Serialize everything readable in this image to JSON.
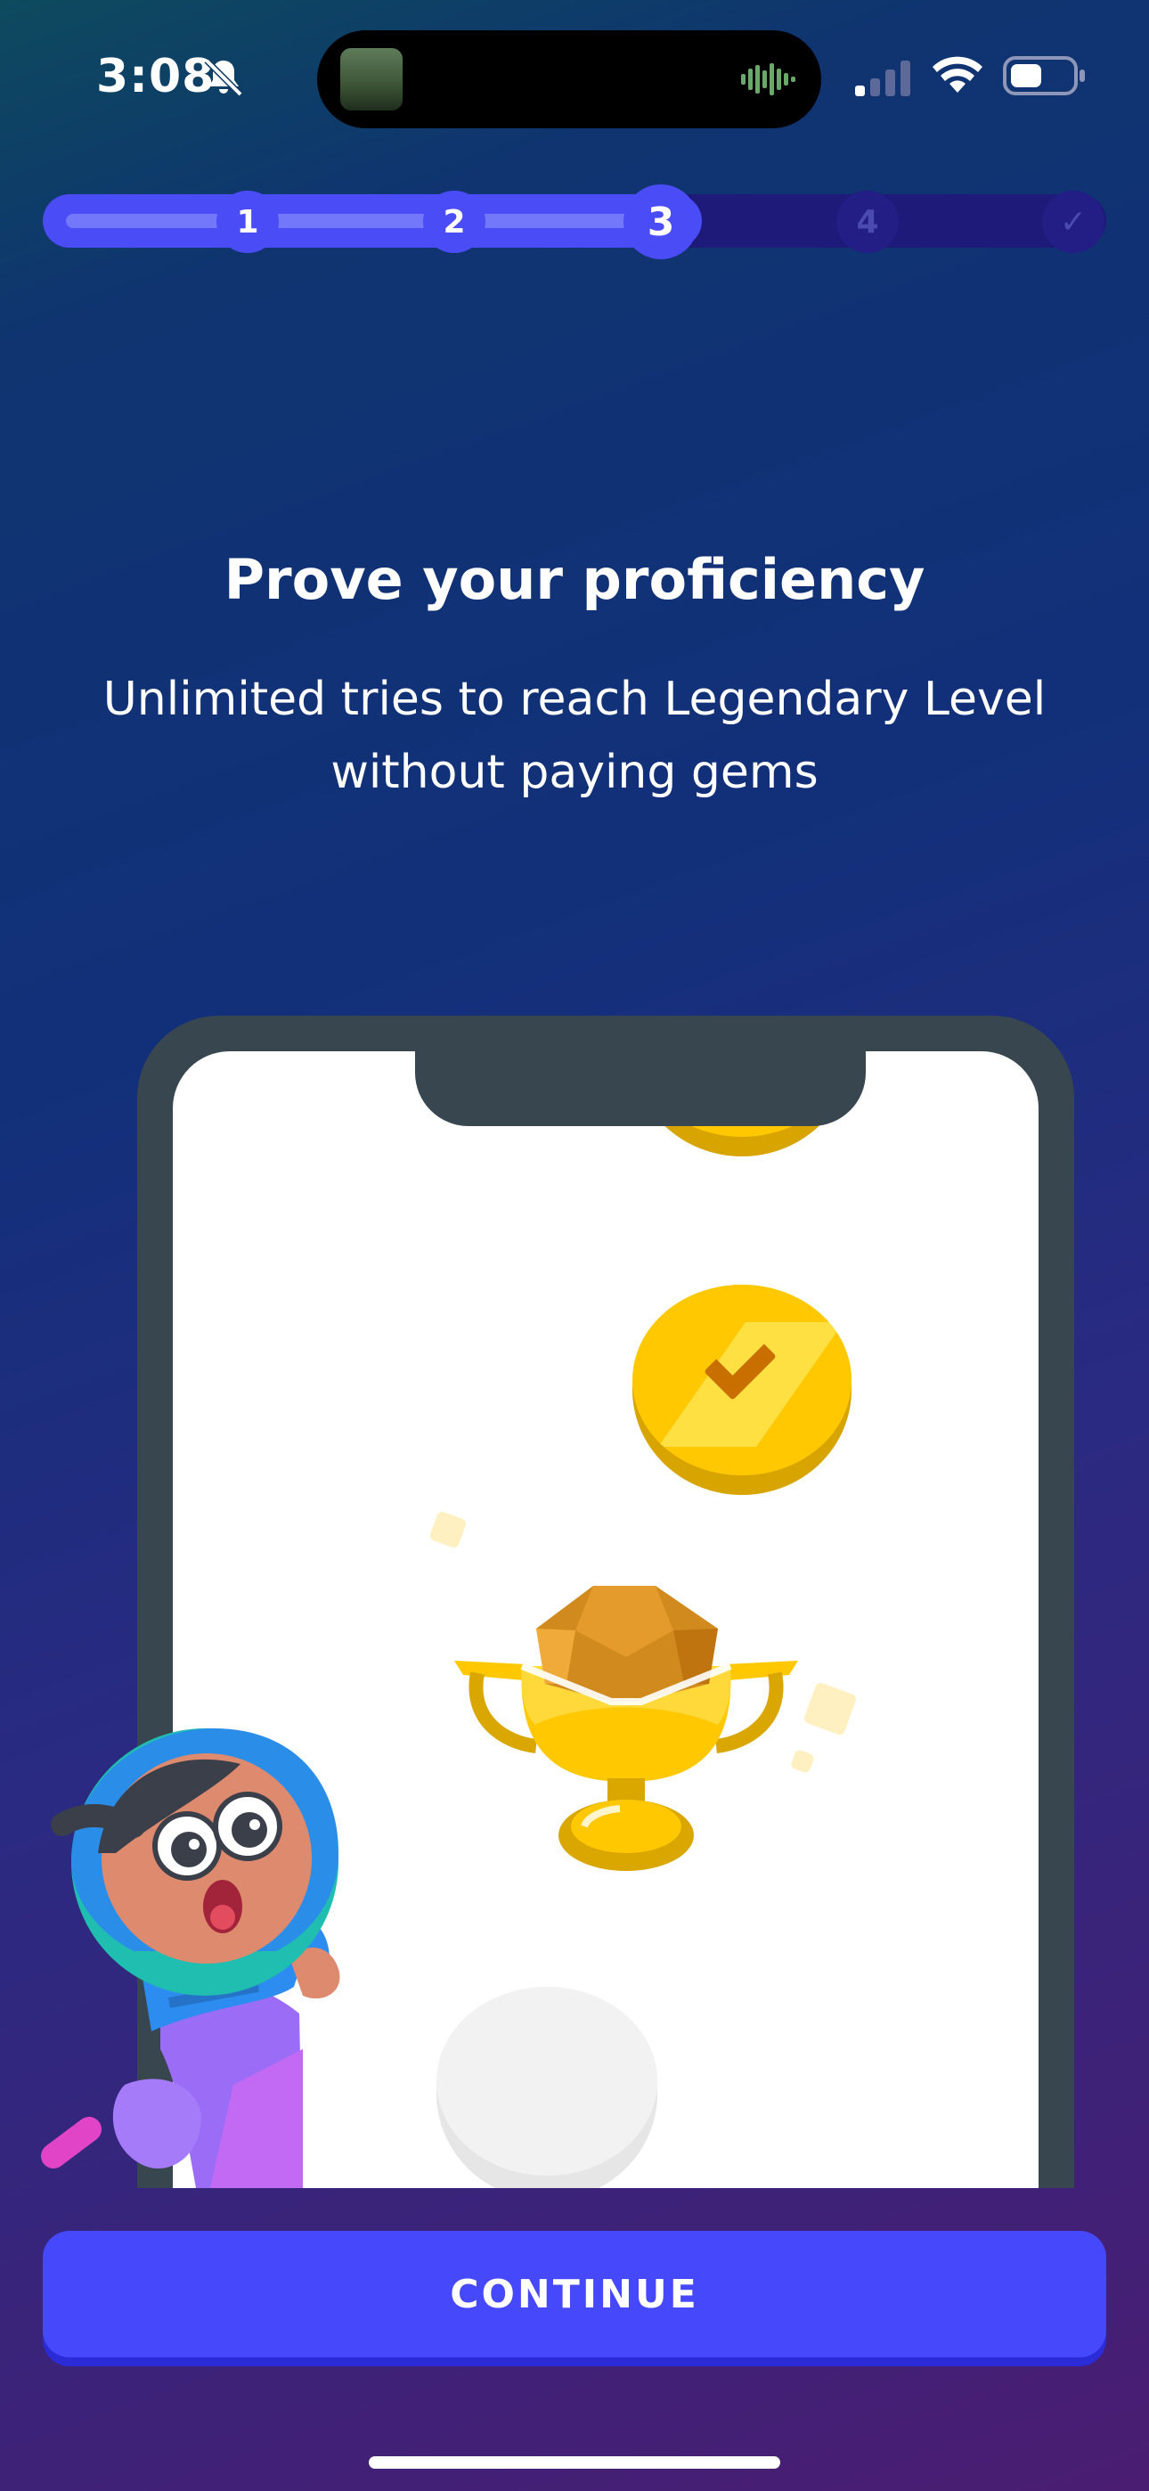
{
  "status_bar": {
    "time": "3:08",
    "icons": [
      "bell-slash-icon",
      "waveform-icon",
      "signal-icon",
      "wifi-icon",
      "battery-icon"
    ]
  },
  "stepper": {
    "steps": [
      {
        "label": "1",
        "state": "done"
      },
      {
        "label": "2",
        "state": "done"
      },
      {
        "label": "3",
        "state": "current"
      },
      {
        "label": "4",
        "state": "todo"
      },
      {
        "label": "✓",
        "state": "todo"
      }
    ]
  },
  "content": {
    "title": "Prove your proficiency",
    "subtitle_line1": "Unlimited tries to reach Legendary Level",
    "subtitle_line2": "without paying gems"
  },
  "illustration": {
    "nodes": [
      "gold-coin-icon",
      "gold-check-coin-icon",
      "trophy-icon",
      "empty-node"
    ]
  },
  "actions": {
    "continue_label": "CONTINUE"
  },
  "colors": {
    "accent": "#4548fb",
    "track": "#1e1a7a",
    "gold": "#ffc800"
  }
}
